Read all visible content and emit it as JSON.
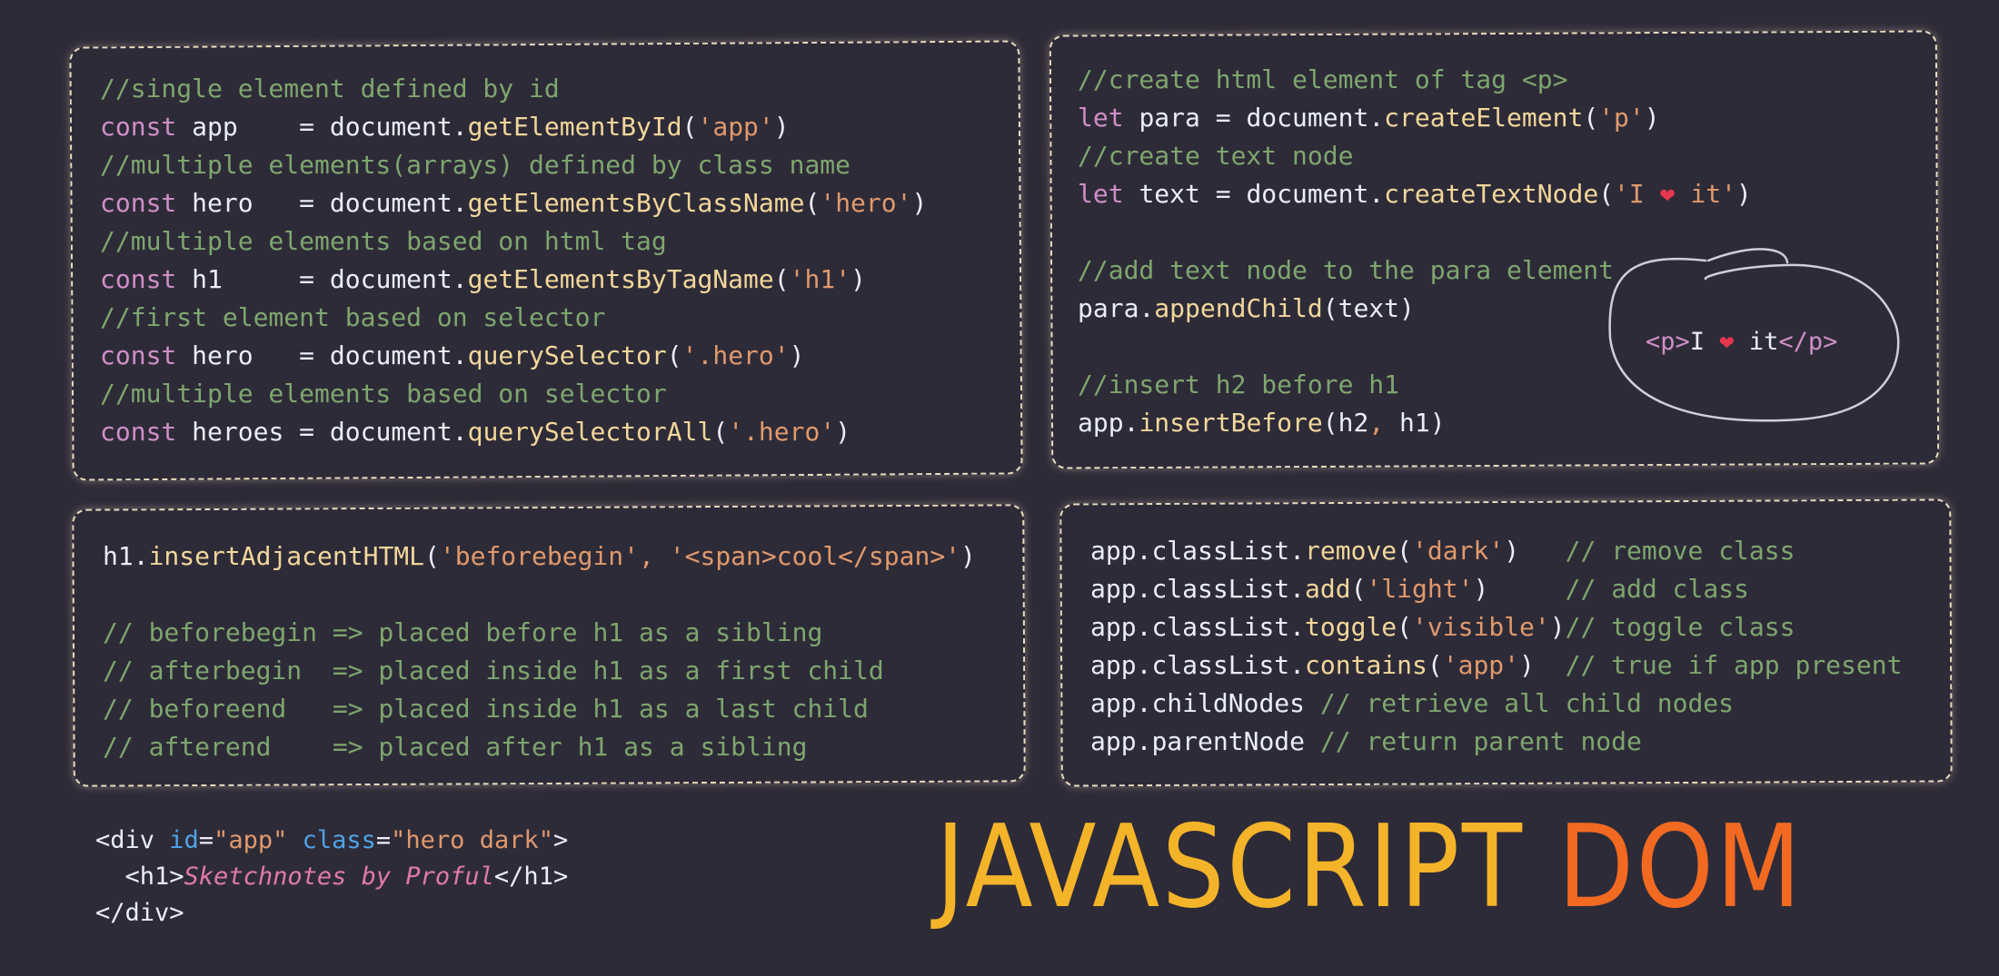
{
  "colors": {
    "background": "#2e2b38",
    "comment": "#7ea66e",
    "keyword": "#cf8fc7",
    "function": "#f2d79b",
    "string": "#e0996c",
    "heart": "#e8384f",
    "title_javascript": "#f4b429",
    "title_dom": "#f26a21"
  },
  "card_select": {
    "c1": "//single element defined by id",
    "l1": {
      "kw": "const ",
      "var": "app    ",
      "eq": "= ",
      "obj": "document",
      "fn": "getElementById",
      "arg": "'app'"
    },
    "c2": "//multiple elements(arrays) defined by class name",
    "l2": {
      "kw": "const ",
      "var": "hero   ",
      "eq": "= ",
      "obj": "document",
      "fn": "getElementsByClassName",
      "arg": "'hero'"
    },
    "c3": "//multiple elements based on html tag",
    "l3": {
      "kw": "const ",
      "var": "h1     ",
      "eq": "= ",
      "obj": "document",
      "fn": "getElementsByTagName",
      "arg": "'h1'"
    },
    "c4": "//first element based on selector",
    "l4": {
      "kw": "const ",
      "var": "hero   ",
      "eq": "= ",
      "obj": "document",
      "fn": "querySelector",
      "arg": "'.hero'"
    },
    "c5": "//multiple elements based on selector",
    "l5": {
      "kw": "const ",
      "var": "heroes ",
      "eq": "= ",
      "obj": "document",
      "fn": "querySelectorAll",
      "arg": "'.hero'"
    }
  },
  "card_create": {
    "c1": "//create html element of tag <p>",
    "l1": {
      "kw": "let ",
      "var": "para ",
      "eq": "= ",
      "obj": "document",
      "fn": "createElement",
      "arg": "'p'"
    },
    "c2": "//create text node",
    "l2": {
      "kw": "let ",
      "var": "text ",
      "eq": "= ",
      "obj": "document",
      "fn": "createTextNode",
      "arg_a": "'I ",
      "heart": "❤",
      "arg_b": " it'"
    },
    "c3": "//add text node to the para element",
    "l3": {
      "obj": "para",
      "fn": "appendChild",
      "arg": "text"
    },
    "c4": "//insert h2 before h1",
    "l4": {
      "obj": "app",
      "fn": "insertBefore",
      "arg1": "h2",
      "comma": ", ",
      "arg2": "h1"
    },
    "bubble": {
      "open": "<p>",
      "text_a": "I ",
      "heart": "❤",
      "text_b": " it",
      "close": "</p>"
    }
  },
  "card_adjacent": {
    "l1": {
      "obj": "h1",
      "fn": "insertAdjacentHTML",
      "arg1": "'beforebegin'",
      "comma": ", ",
      "arg2": "'<span>cool</span>'"
    },
    "c1": "// beforebegin => placed before h1 as a sibling",
    "c2": "// afterbegin  => placed inside h1 as a first child",
    "c3": "// beforeend   => placed inside h1 as a last child",
    "c4": "// afterend    => placed after h1 as a sibling"
  },
  "card_classlist": {
    "l1": {
      "obj": "app",
      "prop": "classList",
      "fn": "remove",
      "arg": "'dark'",
      "pad": "   ",
      "cm": "// remove class"
    },
    "l2": {
      "obj": "app",
      "prop": "classList",
      "fn": "add",
      "arg": "'light'",
      "pad": "     ",
      "cm": "// add class"
    },
    "l3": {
      "obj": "app",
      "prop": "classList",
      "fn": "toggle",
      "arg": "'visible'",
      "pad": "",
      "cm": "// toggle class"
    },
    "l4": {
      "obj": "app",
      "prop": "classList",
      "fn": "contains",
      "arg": "'app'",
      "pad": "  ",
      "cm": "// true if app present"
    },
    "l5": {
      "obj": "app",
      "prop": "childNodes",
      "cm": " // retrieve all child nodes"
    },
    "l6": {
      "obj": "app",
      "prop": "parentNode",
      "cm": " // return parent node"
    }
  },
  "html_snippet": {
    "l1": {
      "open": "<div ",
      "attr1": "id",
      "eq1": "=",
      "val1": "\"app\"",
      "sp": " ",
      "attr2": "class",
      "eq2": "=",
      "val2": "\"hero dark\"",
      "close": ">"
    },
    "l2": {
      "indent": "  ",
      "open": "<h1>",
      "text": "Sketchnotes by Proful",
      "close": "</h1>"
    },
    "l3": {
      "tag": "</div>"
    }
  },
  "title": {
    "word1": "JAVASCRIPT",
    "word2": "DOM"
  }
}
